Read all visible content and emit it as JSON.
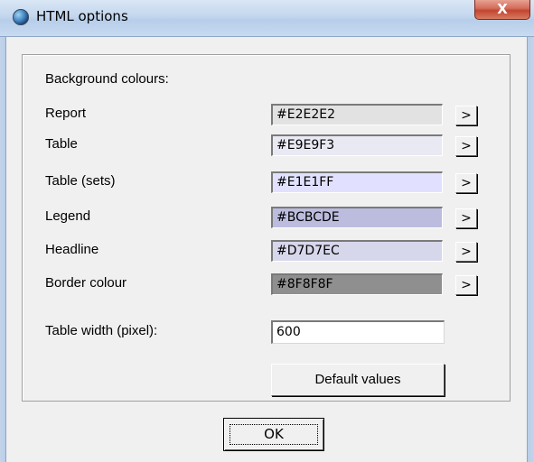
{
  "window": {
    "title": "HTML options",
    "close_label": "X"
  },
  "group": {
    "heading": "Background colours:"
  },
  "colors": [
    {
      "label": "Report",
      "value": "#E2E2E2",
      "swatch": "#E2E2E2",
      "button_label": ">"
    },
    {
      "label": "Table",
      "value": "#E9E9F3",
      "swatch": "#E9E9F3",
      "button_label": ">"
    },
    {
      "label": "Table (sets)",
      "value": "#E1E1FF",
      "swatch": "#E1E1FF",
      "button_label": ">"
    },
    {
      "label": "Legend",
      "value": "#BCBCDE",
      "swatch": "#BCBCDE",
      "button_label": ">"
    },
    {
      "label": "Headline",
      "value": "#D7D7EC",
      "swatch": "#D7D7EC",
      "button_label": ">"
    },
    {
      "label": "Border colour",
      "value": "#8F8F8F",
      "swatch": "#8F8F8F",
      "button_label": ">"
    }
  ],
  "table_width": {
    "label": "Table width (pixel):",
    "value": "600"
  },
  "buttons": {
    "default_values": "Default values",
    "ok": "OK"
  }
}
